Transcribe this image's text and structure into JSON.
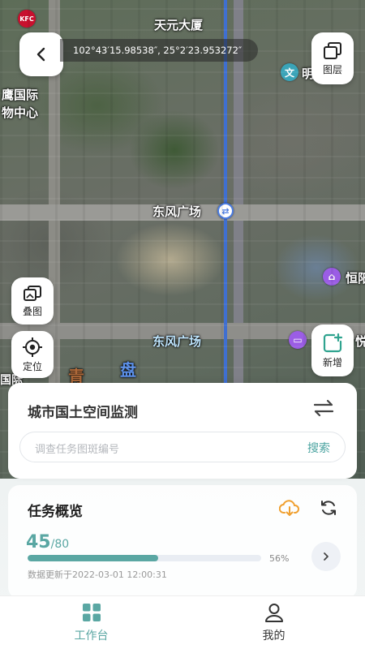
{
  "map": {
    "coordinates": "102°43′15.98538″, 25°2′23.953272″",
    "labels": {
      "tianyuan": "天元大厦",
      "dongfeng_plaza_road": "东风广场",
      "dongfeng_plaza_area": "东风广场",
      "yinghua_1": "鹰国际",
      "yinghua_2": "物中心",
      "ming": "明",
      "heng": "恒阳",
      "yue": "悦",
      "qing": "青",
      "pan": "盘",
      "guoji": "国际",
      "kfc": "KFC"
    }
  },
  "buttons": {
    "layers_label": "图层",
    "overlay_label": "叠图",
    "locate_label": "定位",
    "add_label": "新增"
  },
  "search_card": {
    "title": "城市国土空间监测",
    "placeholder": "调查任务图斑编号",
    "search_label": "搜索"
  },
  "overview": {
    "title": "任务概览",
    "done": "45",
    "total": "/80",
    "progress": 0.56,
    "progress_text": "56%",
    "updated": "数据更新于2022-03-01 12:00:31"
  },
  "tabbar": {
    "workbench": "工作台",
    "mine": "我的"
  },
  "colors": {
    "accent": "#5aa7a3",
    "progress_fill": "#5aa7a3",
    "progress_track": "#e9edf3",
    "download_orange": "#f0a030"
  }
}
